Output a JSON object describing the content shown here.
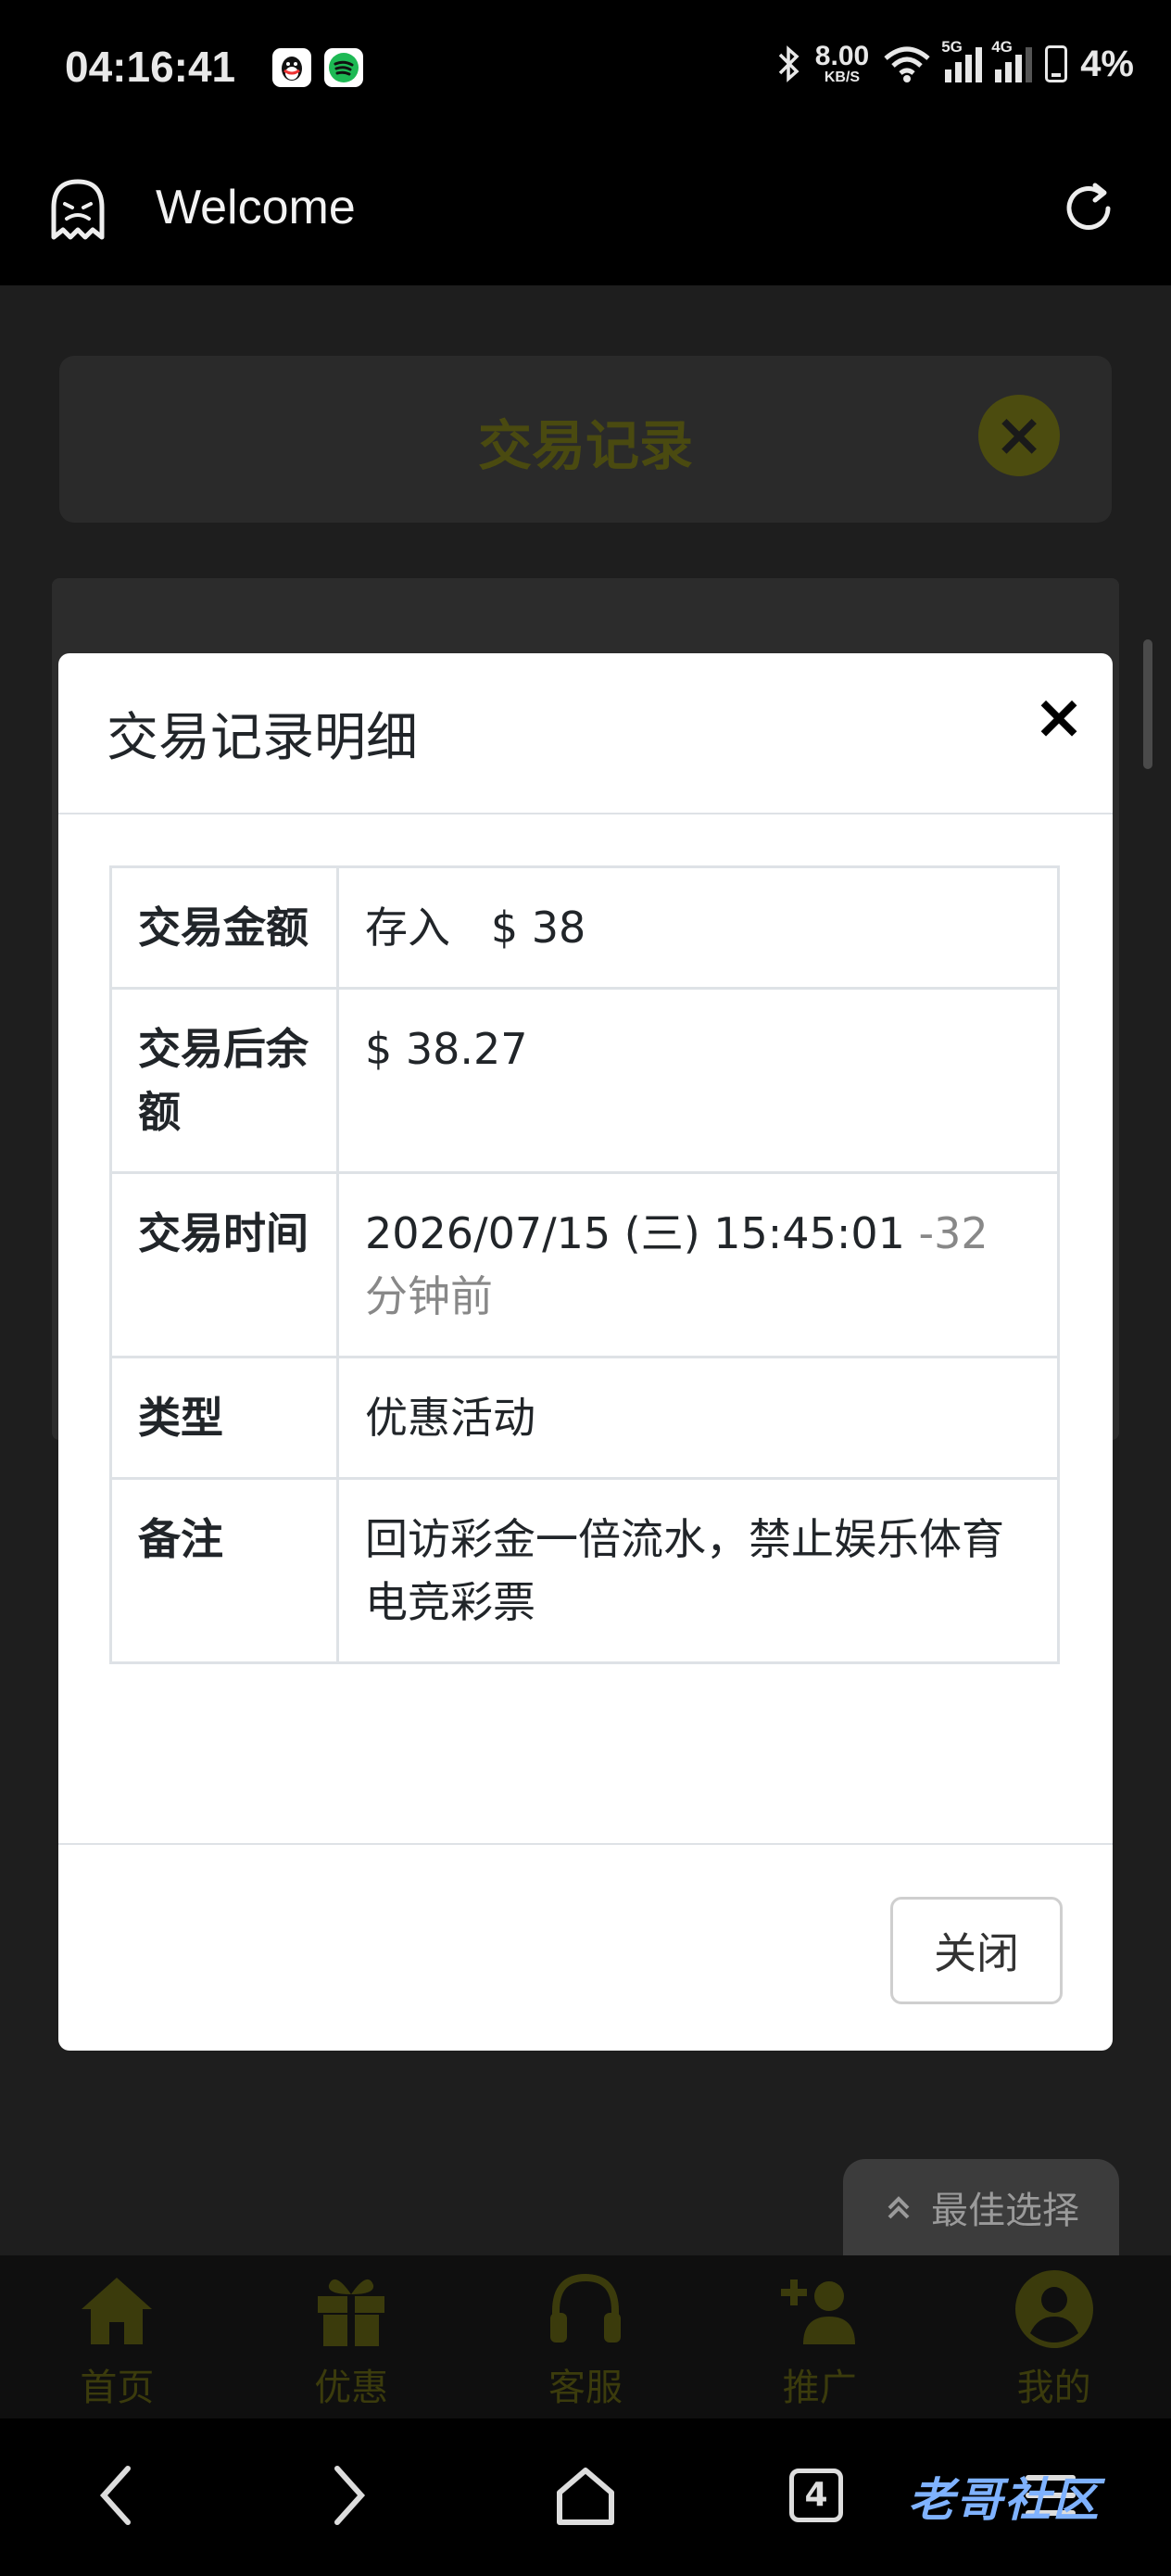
{
  "status_bar": {
    "time": "04:16:41",
    "net_speed_value": "8.00",
    "net_speed_unit": "KB/S",
    "signal_1_label": "5G",
    "signal_2_label": "4G",
    "battery": "4%"
  },
  "browser": {
    "title": "Welcome"
  },
  "background_page": {
    "card_title": "交易记录",
    "best_choice_label": "最佳选择",
    "nav": [
      {
        "label": "首页",
        "icon": "home-icon"
      },
      {
        "label": "优惠",
        "icon": "gift-icon"
      },
      {
        "label": "客服",
        "icon": "headset-icon"
      },
      {
        "label": "推广",
        "icon": "add-users-icon"
      },
      {
        "label": "我的",
        "icon": "user-icon"
      }
    ]
  },
  "modal": {
    "title": "交易记录明细",
    "rows": [
      {
        "key": "交易金额",
        "value_type": "存入",
        "value_amount": "$ 38"
      },
      {
        "key": "交易后余额",
        "value": "$ 38.27"
      },
      {
        "key": "交易时间",
        "value": "2026/07/15 (三) 15:45:01",
        "value_suffix": "-32 分钟前"
      },
      {
        "key": "类型",
        "value": "优惠活动"
      },
      {
        "key": "备注",
        "value": "回访彩金一倍流水，禁止娱乐体育电竞彩票"
      }
    ],
    "close_button": "关闭"
  },
  "system_nav": {
    "tabs_count": "4"
  },
  "watermark": "老哥社区",
  "colors": {
    "deposit_green": "#3f7f3a",
    "accent_dim_yellow": "#4c4c0f"
  }
}
